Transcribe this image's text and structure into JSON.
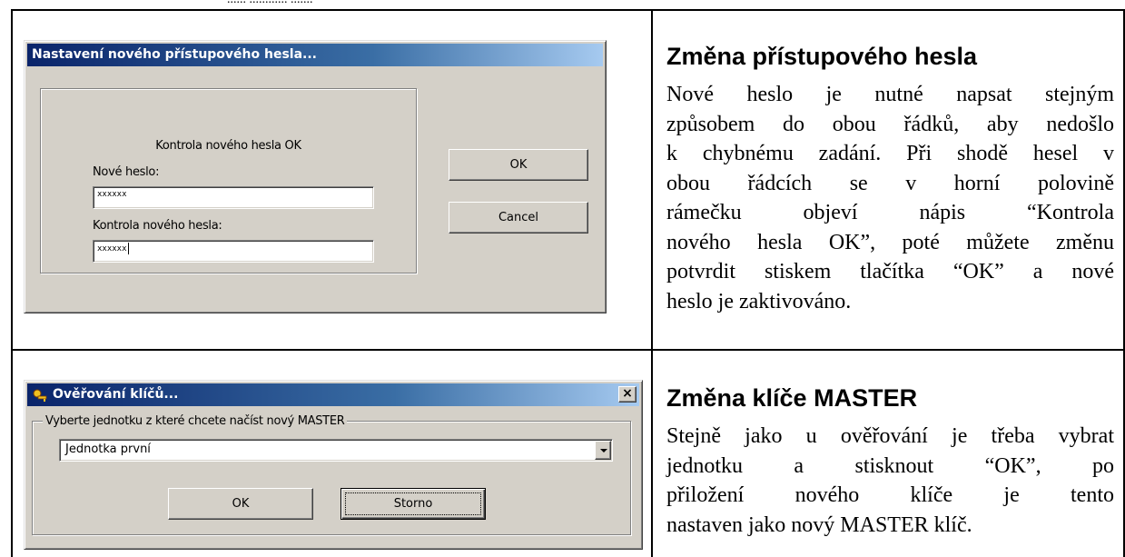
{
  "header_fragment": "...... ............ .......",
  "rows": [
    {
      "heading": "Změna přístupového hesla",
      "paragraph_lines": [
        "Nové heslo je nutné napsat stejným",
        "způsobem do obou řádků, aby nedošlo",
        "k chybnému zadání. Při shodě hesel v",
        "obou řádcích se v horní polovině",
        "rámečku objeví nápis “Kontrola",
        "nového hesla OK”, poté můžete změnu",
        "potvrdit stiskem tlačítka “OK” a nové",
        "heslo je zaktivováno."
      ],
      "dialog": {
        "title": "Nastavení nového přístupového hesla...",
        "status": "Kontrola nového hesla OK",
        "new_password_label": "Nové heslo:",
        "new_password_value": "xxxxxx",
        "confirm_password_label": "Kontrola nového hesla:",
        "confirm_password_value": "xxxxxx",
        "ok_label": "OK",
        "cancel_label": "Cancel"
      }
    },
    {
      "heading": "Změna klíče MASTER",
      "paragraph_lines": [
        "Stejně jako u ověřování je třeba vybrat",
        "jednotku a stisknout “OK”, po",
        "přiložení nového klíče je tento",
        "nastaven jako nový MASTER klíč."
      ],
      "dialog": {
        "title": "Ověřování klíčů...",
        "group_label": "Vyberte jednotku z které chcete načíst nový MASTER",
        "selected_unit": "Jednotka první",
        "ok_label": "OK",
        "cancel_label": "Storno",
        "close_glyph": "×"
      }
    }
  ]
}
